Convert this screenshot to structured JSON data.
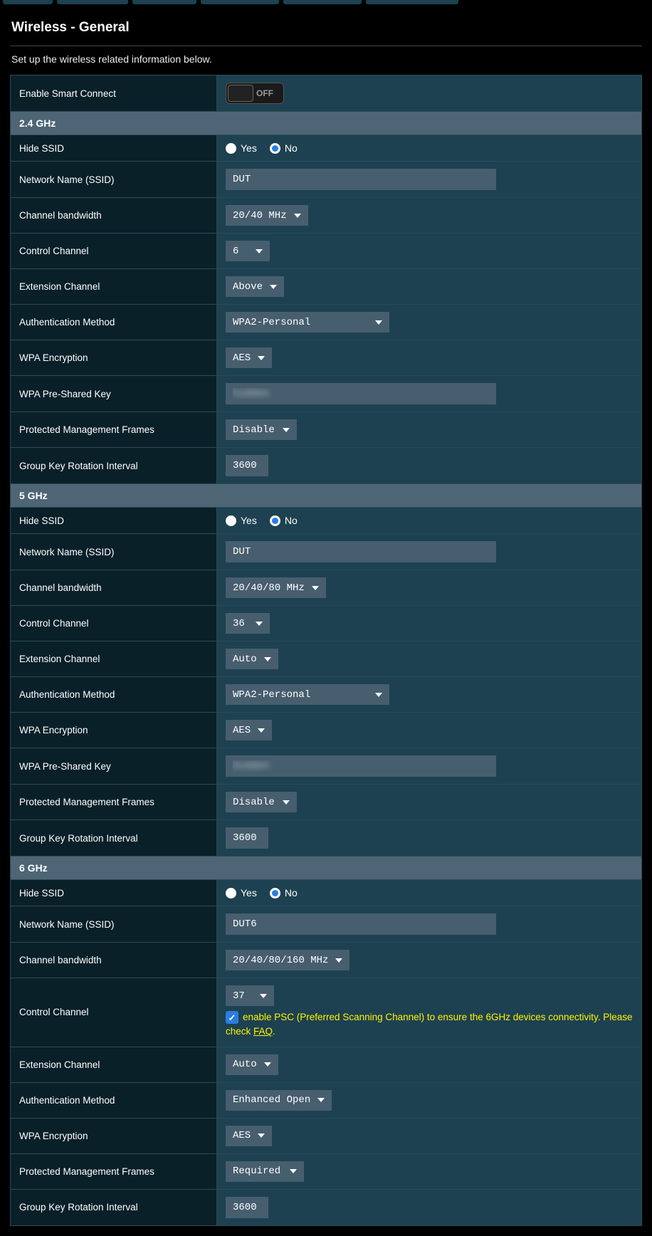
{
  "page": {
    "title": "Wireless - General",
    "subtitle": "Set up the wireless related information below."
  },
  "smart_connect": {
    "label": "Enable Smart Connect",
    "state": "OFF"
  },
  "radio_labels": {
    "yes": "Yes",
    "no": "No"
  },
  "bands": [
    {
      "header": "2.4 GHz",
      "rows": {
        "hide_ssid": {
          "label": "Hide SSID",
          "selected": "no"
        },
        "ssid": {
          "label": "Network Name (SSID)",
          "value": "DUT"
        },
        "bw": {
          "label": "Channel bandwidth",
          "value": "20/40 MHz"
        },
        "ctrl": {
          "label": "Control Channel",
          "value": "6"
        },
        "ext": {
          "label": "Extension Channel",
          "value": "Above"
        },
        "auth": {
          "label": "Authentication Method",
          "value": "WPA2-Personal",
          "wide": true
        },
        "enc": {
          "label": "WPA Encryption",
          "value": "AES"
        },
        "psk": {
          "label": "WPA Pre-Shared Key",
          "value": "hidden"
        },
        "pmf": {
          "label": "Protected Management Frames",
          "value": "Disable"
        },
        "gkr": {
          "label": "Group Key Rotation Interval",
          "value": "3600"
        }
      }
    },
    {
      "header": "5 GHz",
      "rows": {
        "hide_ssid": {
          "label": "Hide SSID",
          "selected": "no"
        },
        "ssid": {
          "label": "Network Name (SSID)",
          "value": "DUT"
        },
        "bw": {
          "label": "Channel bandwidth",
          "value": "20/40/80 MHz"
        },
        "ctrl": {
          "label": "Control Channel",
          "value": "36"
        },
        "ext": {
          "label": "Extension Channel",
          "value": "Auto"
        },
        "auth": {
          "label": "Authentication Method",
          "value": "WPA2-Personal",
          "wide": true
        },
        "enc": {
          "label": "WPA Encryption",
          "value": "AES"
        },
        "psk": {
          "label": "WPA Pre-Shared Key",
          "value": "hidden"
        },
        "pmf": {
          "label": "Protected Management Frames",
          "value": "Disable"
        },
        "gkr": {
          "label": "Group Key Rotation Interval",
          "value": "3600"
        }
      }
    },
    {
      "header": "6 GHz",
      "rows": {
        "hide_ssid": {
          "label": "Hide SSID",
          "selected": "no"
        },
        "ssid": {
          "label": "Network Name (SSID)",
          "value": "DUT6"
        },
        "bw": {
          "label": "Channel bandwidth",
          "value": "20/40/80/160 MHz"
        },
        "ctrl": {
          "label": "Control Channel",
          "value": "37",
          "psc_checked": true,
          "psc_text": "enable PSC (Preferred Scanning Channel) to ensure the 6GHz devices connectivity. Please check ",
          "psc_link": "FAQ",
          "psc_tail": "."
        },
        "ext": {
          "label": "Extension Channel",
          "value": "Auto"
        },
        "auth": {
          "label": "Authentication Method",
          "value": "Enhanced Open"
        },
        "enc": {
          "label": "WPA Encryption",
          "value": "AES"
        },
        "pmf": {
          "label": "Protected Management Frames",
          "value": "Required"
        },
        "gkr": {
          "label": "Group Key Rotation Interval",
          "value": "3600"
        }
      }
    }
  ]
}
